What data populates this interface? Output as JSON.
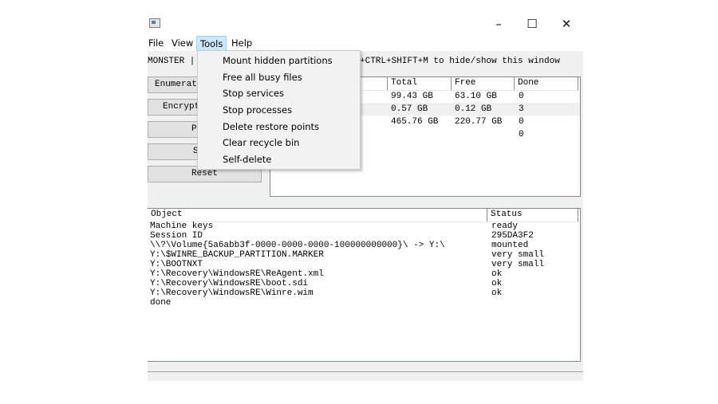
{
  "window": {
    "minimize_symbol": "–",
    "maximize_symbol": "☐",
    "close_symbol": "✕",
    "app_icon": "window-icon"
  },
  "menubar": {
    "file": "File",
    "view": "View",
    "tools": "Tools",
    "help": "Help"
  },
  "info_line": {
    "left": "MONSTER |",
    "right": "+CTRL+SHIFT+M to hide/show this window"
  },
  "buttons": {
    "enumerate": "Enumerat",
    "encrypt": "Encrypt",
    "b3": "P",
    "b4": "S",
    "reset": "Reset"
  },
  "drives": {
    "columns": [
      "Total",
      "Free",
      "Done"
    ],
    "rows": [
      {
        "total": "99.43 GB",
        "free": "63.10 GB",
        "done": "0"
      },
      {
        "total": "0.57 GB",
        "free": "0.12 GB",
        "done": "3"
      },
      {
        "total": "465.76 GB",
        "free": "220.77 GB",
        "done": "0"
      },
      {
        "total": "",
        "free": "",
        "done": "0"
      }
    ]
  },
  "log": {
    "columns": [
      "Object",
      "Status"
    ],
    "rows": [
      {
        "object": "Machine keys",
        "status": "ready"
      },
      {
        "object": "Session ID",
        "status": "295DA3F2"
      },
      {
        "object": "\\\\?\\Volume{5a6abb3f-0000-0000-0000-100000000000}\\ -> Y:\\",
        "status": "mounted"
      },
      {
        "object": "Y:\\$WINRE_BACKUP_PARTITION.MARKER",
        "status": "very small"
      },
      {
        "object": "Y:\\BOOTNXT",
        "status": "very small"
      },
      {
        "object": "Y:\\Recovery\\WindowsRE\\ReAgent.xml",
        "status": "ok"
      },
      {
        "object": "Y:\\Recovery\\WindowsRE\\boot.sdi",
        "status": "ok"
      },
      {
        "object": "Y:\\Recovery\\WindowsRE\\Winre.wim",
        "status": "ok"
      },
      {
        "object": "done",
        "status": ""
      }
    ]
  },
  "tools_menu": {
    "items": [
      "Mount hidden partitions",
      "Free all busy files",
      "Stop services",
      "Stop processes",
      "Delete restore points",
      "Clear recycle bin",
      "Self-delete"
    ]
  }
}
